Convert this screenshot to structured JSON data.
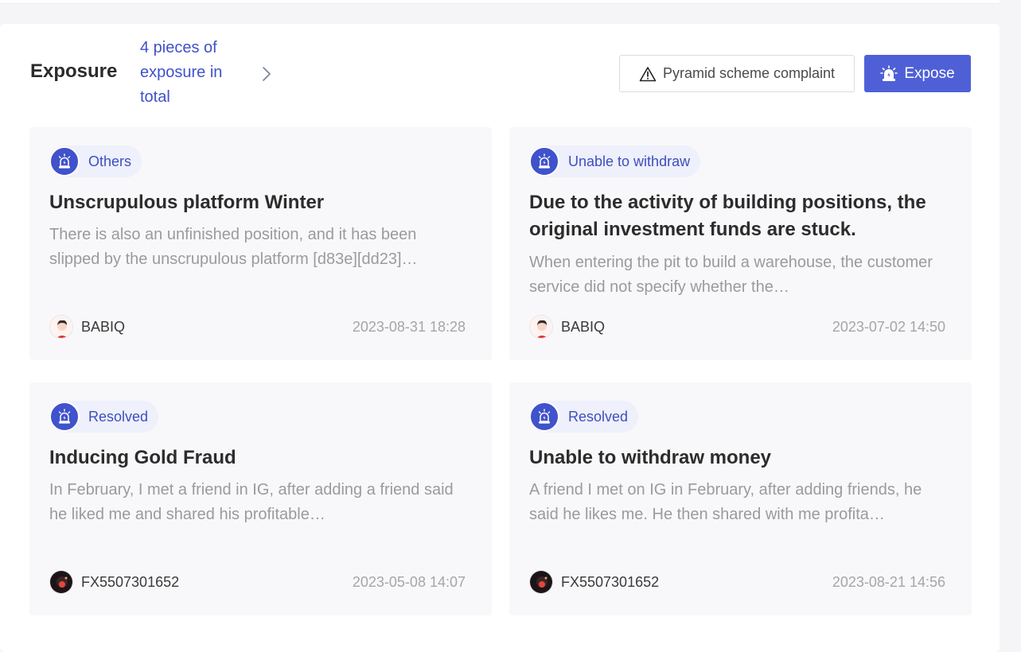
{
  "header": {
    "title": "Exposure",
    "count_text": "4 pieces of exposure in total",
    "pyramid_button": "Pyramid scheme complaint",
    "expose_button": "Expose"
  },
  "colors": {
    "accent": "#4f60d6",
    "tag_text": "#3d4fbe",
    "tag_bg": "#eef0fb",
    "card_bg": "#f8f8fa"
  },
  "cards": [
    {
      "tag": "Others",
      "title": "Unscrupulous platform Winter",
      "description": "There is also an unfinished position, and it has been slipped by the unscrupulous platform [d83e][dd23]…",
      "author": "BABIQ",
      "date": "2023-08-31 18:28",
      "avatar_icon": "cartoon-person-avatar"
    },
    {
      "tag": "Unable to withdraw",
      "title": "Due to the activity of building positions, the original investment funds are stuck.",
      "description": "When entering the pit to build a warehouse, the customer service did not specify whether the…",
      "author": "BABIQ",
      "date": "2023-07-02 14:50",
      "avatar_icon": "cartoon-person-avatar"
    },
    {
      "tag": "Resolved",
      "title": "Inducing Gold Fraud",
      "description": "In February, I met a friend in IG, after adding a friend said he liked me and shared his profitable…",
      "author": "FX5507301652",
      "date": "2023-05-08 14:07",
      "avatar_icon": "dark-photo-avatar"
    },
    {
      "tag": "Resolved",
      "title": "Unable to withdraw money",
      "description": "A friend I met on IG in February, after adding friends, he said he likes me. He then shared with me profita…",
      "author": "FX5507301652",
      "date": "2023-08-21 14:56",
      "avatar_icon": "dark-photo-avatar"
    }
  ]
}
